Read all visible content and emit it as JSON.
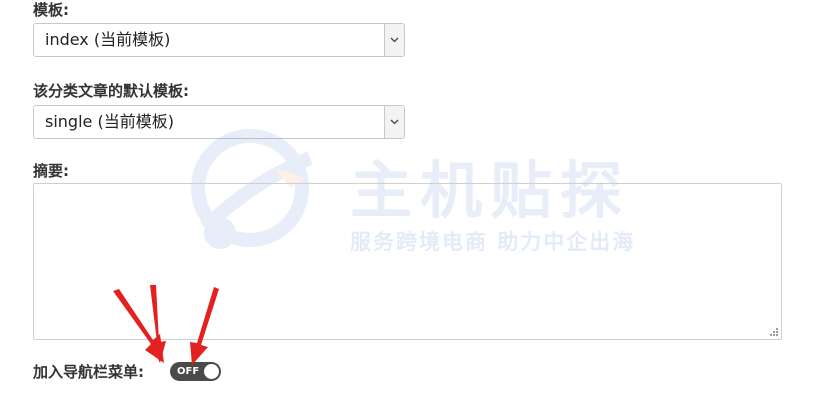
{
  "template_field": {
    "label": "模板:",
    "selected": "index (当前模板)",
    "dropdown_icon": "chevron-down-icon"
  },
  "category_template_field": {
    "label": "该分类文章的默认模板:",
    "selected": "single (当前模板)",
    "dropdown_icon": "chevron-down-icon"
  },
  "summary_field": {
    "label": "摘要:",
    "value": ""
  },
  "watermark": {
    "title": "主机贴探",
    "subtitle": "服务跨境电商 助力中企出海"
  },
  "nav_menu_field": {
    "label": "加入导航栏菜单:",
    "toggle_text": "OFF",
    "toggle_state": "off"
  },
  "annotations": {
    "arrow_color": "#e52020"
  }
}
